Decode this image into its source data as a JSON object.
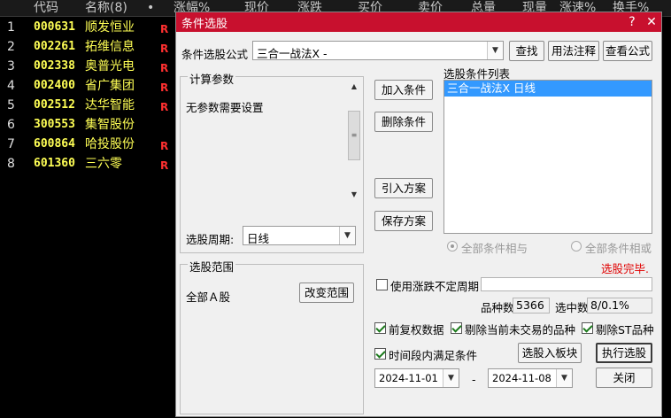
{
  "list_header": {
    "code": "代码",
    "name": "名称(8)",
    "dot": "•",
    "change_pct": "涨幅%",
    "price": "现价",
    "change": "涨跌",
    "bid": "买价",
    "ask": "卖价",
    "volume": "总量",
    "current_vol": "现量",
    "speed": "涨速%",
    "turnover": "换手%"
  },
  "stocks": [
    {
      "num": "1",
      "code": "000631",
      "name": "顺发恒业",
      "mark": "R"
    },
    {
      "num": "2",
      "code": "002261",
      "name": "拓维信息",
      "mark": "R"
    },
    {
      "num": "3",
      "code": "002338",
      "name": "奥普光电",
      "mark": "R"
    },
    {
      "num": "4",
      "code": "002400",
      "name": "省广集团",
      "mark": "R"
    },
    {
      "num": "5",
      "code": "002512",
      "name": "达华智能",
      "mark": "R"
    },
    {
      "num": "6",
      "code": "300553",
      "name": "集智股份",
      "mark": ""
    },
    {
      "num": "7",
      "code": "600864",
      "name": "哈投股份",
      "mark": "R"
    },
    {
      "num": "8",
      "code": "601360",
      "name": "三六零",
      "mark": "R"
    }
  ],
  "dialog": {
    "title": "条件选股",
    "help_btn": "?",
    "close_btn": "✕",
    "formula_label": "条件选股公式",
    "formula_value": "三合一战法X  -",
    "find_btn": "查找",
    "usage_btn": "用法注释",
    "view_btn": "查看公式",
    "params_group": "计算参数",
    "params_text": "无参数需要设置",
    "period_label": "选股周期:",
    "period_value": "日线",
    "add_btn": "加入条件",
    "delete_btn": "删除条件",
    "import_btn": "引入方案",
    "save_btn": "保存方案",
    "conditions_label": "选股条件列表",
    "conditions": [
      "三合一战法X  日线"
    ],
    "radio_and": "全部条件相与",
    "radio_or": "全部条件相或",
    "status": "选股完毕.",
    "scope_group": "选股范围",
    "scope_value": "全部Ａ股",
    "change_scope_btn": "改变范围",
    "uncertain_period": "使用涨跌不定周期",
    "count_label": "品种数",
    "count_value": "5366",
    "selected_label": "选中数",
    "selected_value": "8/0.1%",
    "adj_label": "前复权数据",
    "remove_untraded": "剔除当前未交易的品种",
    "remove_st": "剔除ST品种",
    "time_condition": "时间段内满足条件",
    "to_block_btn": "选股入板块",
    "run_btn": "执行选股",
    "date_from": "2024-11-01",
    "date_sep": "-",
    "date_to": "2024-11-08",
    "close_dialog_btn": "关闭"
  },
  "colors": {
    "title_bar": "#c8102e",
    "code_text": "#ffff55",
    "mark": "#ff3030",
    "status": "#e00000",
    "selection": "#3399ff"
  }
}
